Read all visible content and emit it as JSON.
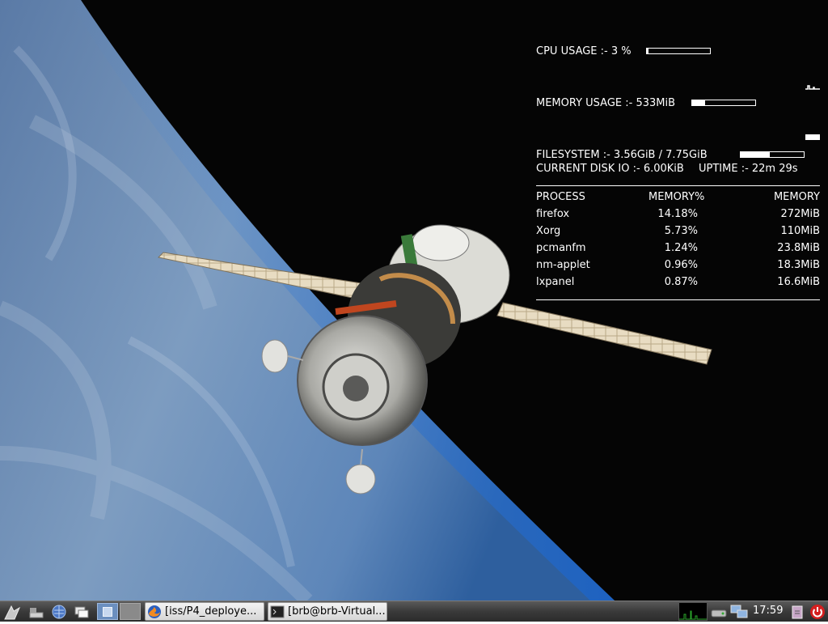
{
  "conky": {
    "cpu_label": "CPU USAGE :- 3 %",
    "cpu_fraction": 0.03,
    "memory_label": "MEMORY USAGE :- 533MiB",
    "memory_fraction": 0.2,
    "filesystem_label": "FILESYSTEM :-  3.56GiB / 7.75GiB",
    "filesystem_fraction": 0.46,
    "disk_io_label": "CURRENT DISK IO :- 6.00KiB",
    "uptime_label": "UPTIME  :-  22m 29s",
    "process_headers": {
      "name": "PROCESS",
      "pct": "MEMORY%",
      "mem": "MEMORY"
    },
    "processes": [
      {
        "name": "firefox",
        "pct": "14.18%",
        "mem": "272MiB"
      },
      {
        "name": "Xorg",
        "pct": "5.73%",
        "mem": "110MiB"
      },
      {
        "name": "pcmanfm",
        "pct": "1.24%",
        "mem": "23.8MiB"
      },
      {
        "name": "nm-applet",
        "pct": "0.96%",
        "mem": "18.3MiB"
      },
      {
        "name": "lxpanel",
        "pct": "0.87%",
        "mem": "16.6MiB"
      }
    ]
  },
  "taskbar": {
    "tasks": [
      {
        "label": "[iss/P4_deploye...",
        "icon": "firefox-icon"
      },
      {
        "label": "[brb@brb-Virtual...",
        "icon": "terminal-icon"
      }
    ],
    "clock": "17:59",
    "launchers": [
      "lxde-menu-icon",
      "show-desktop-icon",
      "file-manager-icon",
      "web-browser-icon",
      "window-switcher-icon"
    ],
    "workspaces": 2,
    "active_workspace": 1,
    "tray": [
      "cpu-monitor-icon",
      "removable-drive-icon",
      "network-icon",
      "volume-icon",
      "logout-icon"
    ],
    "colors": {
      "panel": "#3a3a3a",
      "workspace_active": "#6b8fbf",
      "cpu_graph": "#2aa52a",
      "logout": "#d41f1f"
    }
  }
}
